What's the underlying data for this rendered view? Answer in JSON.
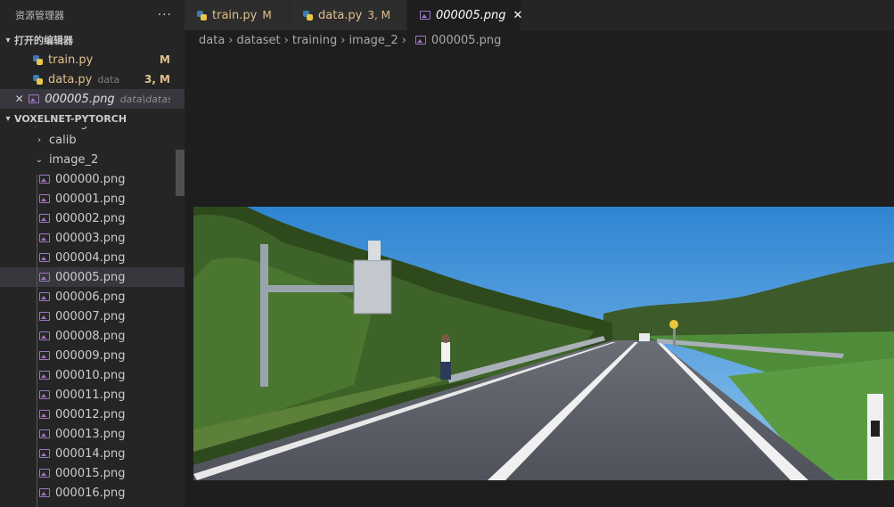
{
  "sidebar": {
    "title": "资源管理器",
    "more_label": "···",
    "open_editors": {
      "label": "打开的编辑器",
      "items": [
        {
          "name": "train.py",
          "hint": "",
          "badge": "M"
        },
        {
          "name": "data.py",
          "hint": "data",
          "badge": "3, M"
        },
        {
          "name": "000005.png",
          "hint": "data\\dataset..."
        }
      ],
      "close_label": "✕"
    },
    "project": {
      "label": "VOXELNET-PYTORCH",
      "partial_folder": "training",
      "folders": [
        "calib",
        "image_2"
      ],
      "files": [
        "000000.png",
        "000001.png",
        "000002.png",
        "000003.png",
        "000004.png",
        "000005.png",
        "000006.png",
        "000007.png",
        "000008.png",
        "000009.png",
        "000010.png",
        "000011.png",
        "000012.png",
        "000013.png",
        "000014.png",
        "000015.png",
        "000016.png"
      ],
      "selected_file": "000005.png"
    }
  },
  "tabs": [
    {
      "label": "train.py",
      "badge": "M"
    },
    {
      "label": "data.py",
      "badge": "3, M"
    },
    {
      "label": "000005.png",
      "close": "✕"
    }
  ],
  "breadcrumb": [
    "data",
    "dataset",
    "training",
    "image_2",
    "000005.png"
  ],
  "colors": {
    "modified": "#e2c08d",
    "image_icon": "#a074c4",
    "python_blue": "#3e7ab6",
    "python_yellow": "#e7c84a"
  }
}
